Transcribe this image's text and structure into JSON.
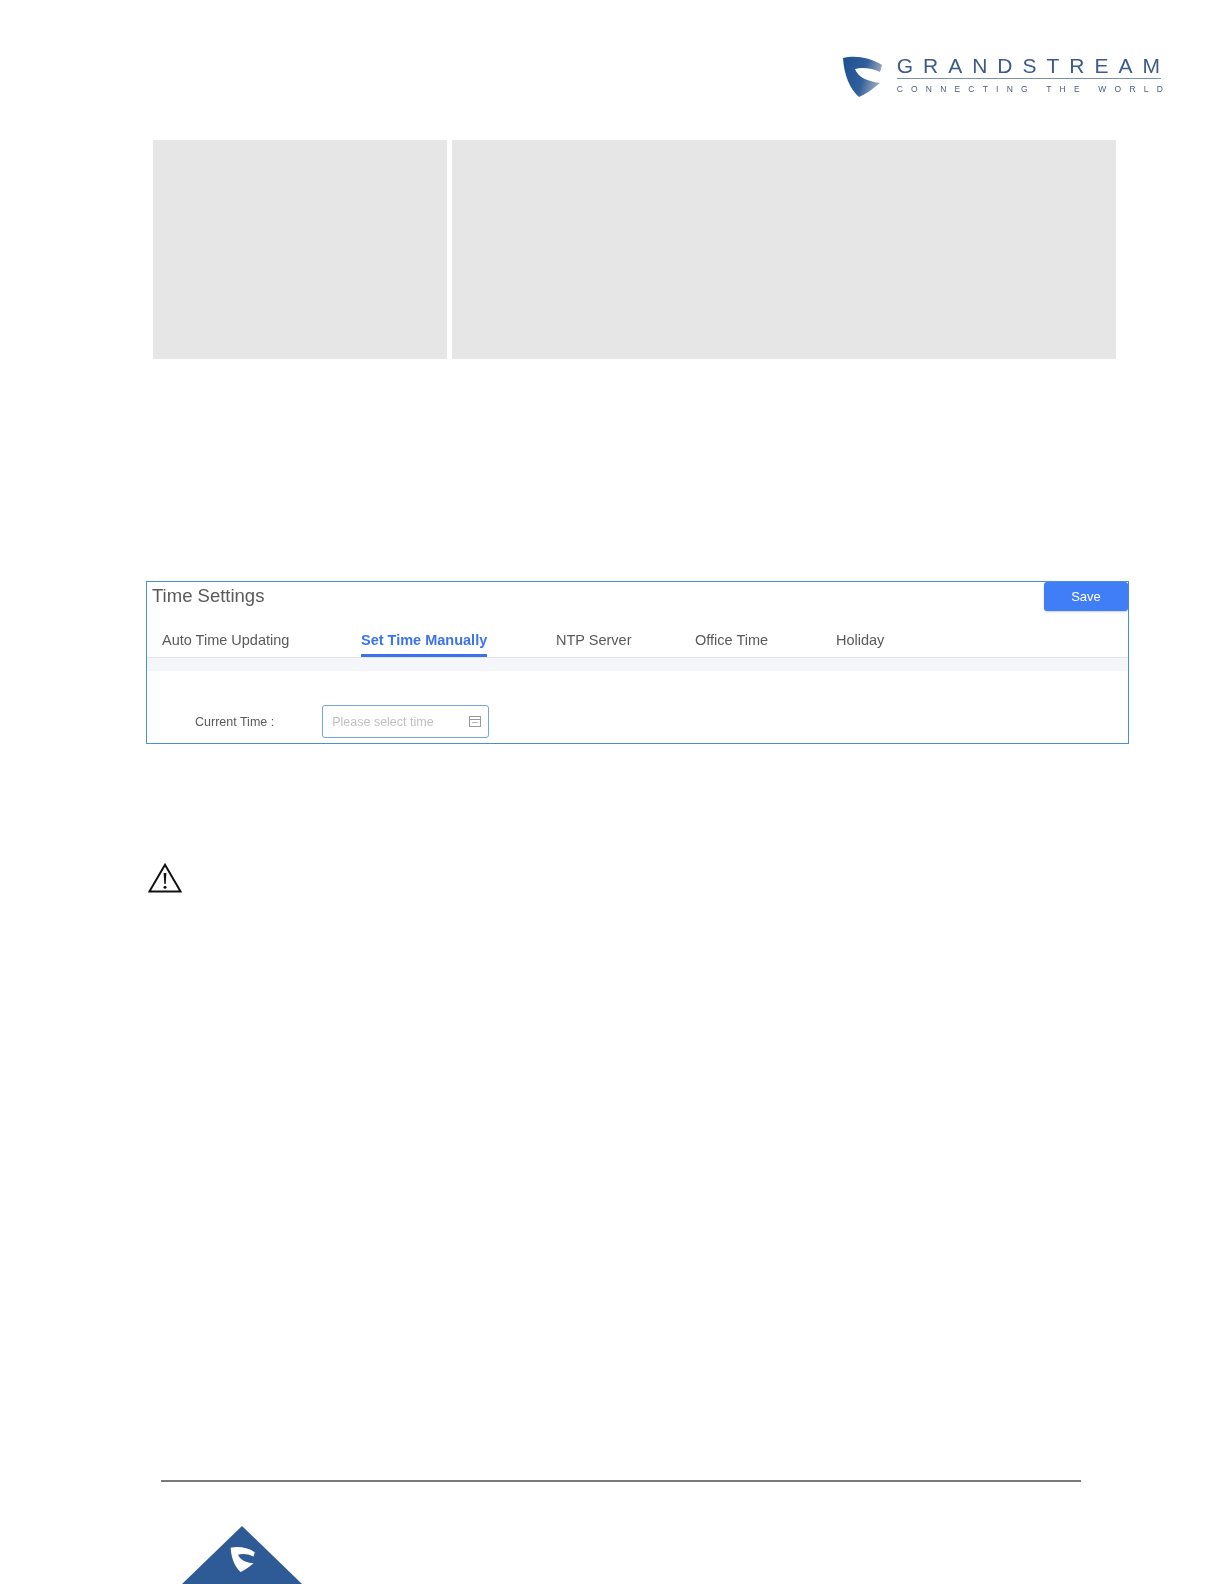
{
  "logo": {
    "name": "GRANDSTREAM",
    "tagline": "CONNECTING THE WORLD"
  },
  "time_settings": {
    "title": "Time Settings",
    "save_label": "Save",
    "tabs": [
      {
        "label": "Auto Time Updating",
        "selected": false
      },
      {
        "label": "Set Time Manually",
        "selected": true
      },
      {
        "label": "NTP Server",
        "selected": false
      },
      {
        "label": "Office Time",
        "selected": false
      },
      {
        "label": "Holiday",
        "selected": false
      }
    ],
    "fields": [
      {
        "label": "Current Time :",
        "placeholder": "Please select time"
      }
    ]
  }
}
